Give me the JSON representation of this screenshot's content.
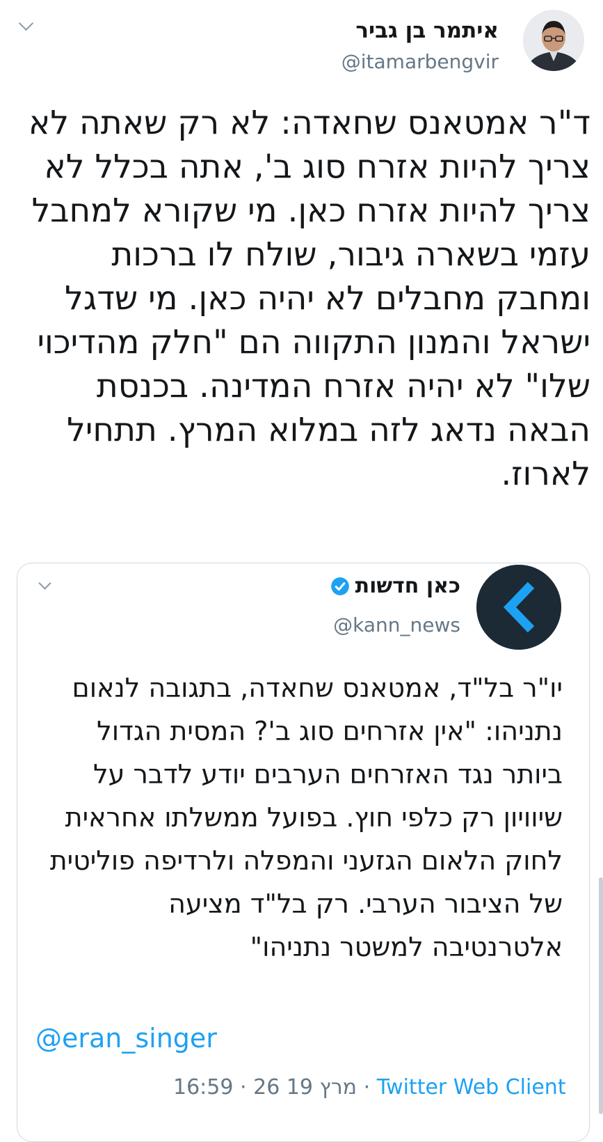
{
  "tweet": {
    "author_name": "איתמר בן גביר",
    "author_handle": "@itamarbengvir",
    "text": "ד\"ר אמטאנס שחאדה: לא רק שאתה לא צריך להיות אזרח סוג ב', אתה בכלל לא צריך להיות אזרח כאן. מי שקורא למחבל עזמי בשארה גיבור, שולח לו ברכות ומחבק מחבלים לא יהיה כאן. מי שדגל ישראל והמנון התקווה הם \"חלק מהדיכוי שלו\" לא יהיה אזרח המדינה. בכנסת הבאה נדאג לזה במלוא המרץ. תתחיל לארוז."
  },
  "quoted_tweet": {
    "author_name": "כאן חדשות",
    "author_handle": "@kann_news",
    "verified": true,
    "text": "יו\"ר בל\"ד, אמטאנס שחאדה, בתגובה לנאום נתניהו: \"אין אזרחים סוג ב'? המסית הגדול ביותר נגד האזרחים הערבים יודע לדבר על שיוויון רק כלפי חוץ. בפועל ממשלתו אחראית לחוק הלאום הגזעני והמפלה ולרדיפה פוליטית של הציבור הערבי. רק בל\"ד מציעה אלטרנטיבה למשטר נתניהו\"",
    "mention": "@eran_singer",
    "time": "16:59",
    "date": "26 מרץ 19",
    "client": "Twitter Web Client",
    "separator": "·"
  },
  "icons": {
    "menu": "chevron-down-icon",
    "verified": "verified-badge-icon",
    "kann_logo": "kann-logo-icon"
  },
  "colors": {
    "link": "#1da1f2",
    "secondary_text": "#657786",
    "kann_logo_bg": "#1c2a36"
  }
}
